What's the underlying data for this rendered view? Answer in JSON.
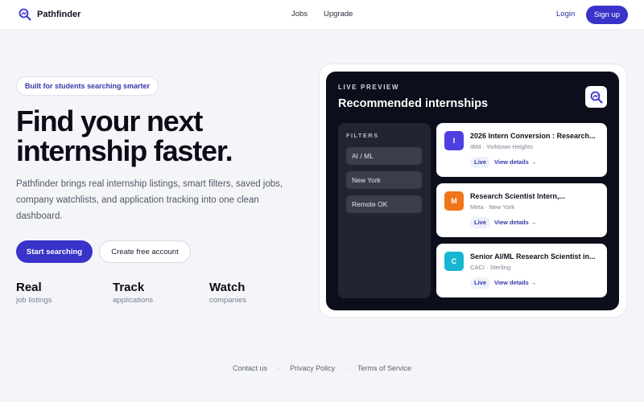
{
  "header": {
    "brand": "Pathfinder",
    "nav": [
      "Jobs",
      "Upgrade"
    ],
    "login": "Login",
    "signup": "Sign up"
  },
  "hero": {
    "pill": "Built for students searching smarter",
    "title": "Find your next internship faster.",
    "description": "Pathfinder brings real internship listings, smart filters, saved jobs, company watchlists, and application tracking into one clean dashboard.",
    "primary_button": "Start searching",
    "secondary_button": "Create free account",
    "stats": [
      {
        "title": "Real",
        "subtitle": "job listings"
      },
      {
        "title": "Track",
        "subtitle": "applications"
      },
      {
        "title": "Watch",
        "subtitle": "companies"
      }
    ]
  },
  "preview": {
    "label": "LIVE PREVIEW",
    "title": "Recommended internships",
    "filters_label": "FILTERS",
    "filters": [
      "AI / ML",
      "New York",
      "Remote OK"
    ],
    "cards": [
      {
        "badge": "I",
        "badge_color": "#4f3fe0",
        "title": "2026 Intern Conversion : Research...",
        "meta": "IBM · Yorktown Heights",
        "status": "Live",
        "link": "View details →"
      },
      {
        "badge": "M",
        "badge_color": "#f07418",
        "title": "Research Scientist Intern,...",
        "meta": "Meta · New York",
        "status": "Live",
        "link": "View details →"
      },
      {
        "badge": "C",
        "badge_color": "#17b6d0",
        "title": "Senior AI/ML Research Scientist in...",
        "meta": "CACI · Sterling",
        "status": "Live",
        "link": "View details →"
      }
    ]
  },
  "footer": {
    "links": [
      "Contact us",
      "Privacy Policy",
      "Terms of Service"
    ],
    "separator": "·"
  },
  "colors": {
    "accent": "#3a33c9",
    "preview_bg": "#0c0e1c",
    "page_bg": "#f4f5f9"
  }
}
